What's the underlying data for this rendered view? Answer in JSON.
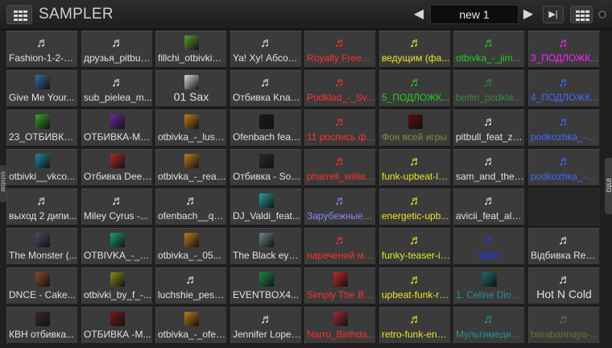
{
  "topbar": {
    "title": "SAMPLER",
    "bank_name": "new 1",
    "prev_glyph": "◀",
    "next_glyph": "▶",
    "skip_glyph": "▶|"
  },
  "left_sidebar_label": "sidebar",
  "right_panel_label": "info",
  "colors": {
    "white": "#e2e2e2",
    "red": "#ff3030",
    "yellow": "#e8e82a",
    "green": "#22cc22",
    "magenta": "#ff22ff",
    "blue": "#4466ff",
    "olive": "#8a8a3a",
    "darkgreen": "#3a8a3a",
    "darkteal": "#2a8f8f",
    "lavender": "#8888ff",
    "darkolive": "#6e6e32",
    "bluebright": "#2233ff"
  },
  "pads": [
    [
      {
        "label": "Fashion-1-2-3-...",
        "color": "white",
        "icon": "music-note-icon"
      },
      {
        "label": "друзья_pitbull...",
        "color": "white",
        "icon": "music-note-icon"
      },
      {
        "label": "fillchi_otbivki_-...",
        "color": "white",
        "icon": "album-cover-icon",
        "cover": "#5a9a2a"
      },
      {
        "label": "Ya! Xy! Абсол...",
        "color": "white",
        "icon": "music-note-icon"
      },
      {
        "label": "Royalty Free...",
        "color": "red",
        "icon": "music-note-icon"
      },
      {
        "label": "ведущим (фа...",
        "color": "yellow",
        "icon": "music-note-icon"
      },
      {
        "label": "otbivka_-_jim...",
        "color": "green",
        "icon": "music-note-icon"
      },
      {
        "label": "3_ПОДЛОЖК...",
        "color": "magenta",
        "icon": "music-note-icon"
      }
    ],
    [
      {
        "label": "Give Me Your...",
        "color": "white",
        "icon": "album-cover-icon",
        "cover": "#3a6aa0"
      },
      {
        "label": "sub_pielea_m...",
        "color": "white",
        "icon": "music-note-icon"
      },
      {
        "label": "01 Sax",
        "color": "white",
        "icon": "album-cover-icon",
        "cover": "#d9d9d9",
        "big": true
      },
      {
        "label": "Отбивка Knag...",
        "color": "white",
        "icon": "music-note-icon"
      },
      {
        "label": "Podklad_-_Sv...",
        "color": "red",
        "icon": "music-note-icon"
      },
      {
        "label": "5_ПОДЛОЖК...",
        "color": "green",
        "icon": "music-note-icon"
      },
      {
        "label": "berlin_podkla...",
        "color": "darkgreen",
        "icon": "music-note-icon"
      },
      {
        "label": "4_ПОДЛОЖК...",
        "color": "blue",
        "icon": "music-note-icon"
      }
    ],
    [
      {
        "label": "23_ОТБИВКА...",
        "color": "white",
        "icon": "album-cover-icon",
        "cover": "#3aa02a"
      },
      {
        "label": "ОТБИВКА-Му...",
        "color": "white",
        "icon": "album-cover-icon",
        "cover": "#6a2aa0"
      },
      {
        "label": "otbivka_-_lush...",
        "color": "white",
        "icon": "album-cover-icon",
        "cover": "#c07a1a"
      },
      {
        "label": "Ofenbach feat...",
        "color": "white",
        "icon": "album-cover-icon",
        "cover": "#1a1a1a"
      },
      {
        "label": "11 роспись ф...",
        "color": "red",
        "icon": "music-note-icon"
      },
      {
        "label": "Фон всей игры",
        "color": "olive",
        "icon": "album-cover-icon",
        "cover": "#5a1010"
      },
      {
        "label": "pitbull_feat_za...",
        "color": "white",
        "icon": "music-note-icon"
      },
      {
        "label": "podkozhka_-_j...",
        "color": "blue",
        "icon": "music-note-icon"
      }
    ],
    [
      {
        "label": "otbivki__vkco...",
        "color": "white",
        "icon": "album-cover-icon",
        "cover": "#1a8aa0"
      },
      {
        "label": "Отбивка Deep...",
        "color": "white",
        "icon": "album-cover-icon",
        "cover": "#b02a2a"
      },
      {
        "label": "otbivka_-_read...",
        "color": "white",
        "icon": "album-cover-icon",
        "cover": "#c07a1a"
      },
      {
        "label": "Отбивка - Sou...",
        "color": "white",
        "icon": "album-cover-icon",
        "cover": "#2a2a2a"
      },
      {
        "label": "pharrell_willia...",
        "color": "red",
        "icon": "music-note-icon"
      },
      {
        "label": "funk-upbeat-lo...",
        "color": "yellow",
        "icon": "music-note-icon"
      },
      {
        "label": "sam_and_the_...",
        "color": "white",
        "icon": "music-note-icon"
      },
      {
        "label": "podkozhka_-_v...",
        "color": "blue",
        "icon": "music-note-icon"
      }
    ],
    [
      {
        "label": "выход 2 дипи...",
        "color": "white",
        "icon": "music-note-icon"
      },
      {
        "label": "Miley Cyrus -...",
        "color": "white",
        "icon": "music-note-icon"
      },
      {
        "label": "ofenbach__qu...",
        "color": "white",
        "icon": "music-note-icon"
      },
      {
        "label": "DJ_Valdi_feat...",
        "color": "white",
        "icon": "album-cover-icon",
        "cover": "#2aa0a0"
      },
      {
        "label": "Зарубежные х...",
        "color": "lavender",
        "icon": "music-note-icon"
      },
      {
        "label": "energetic-upb...",
        "color": "yellow",
        "icon": "music-note-icon"
      },
      {
        "label": "avicii_feat_alo...",
        "color": "white",
        "icon": "music-note-icon"
      },
      {
        "empty": true
      }
    ],
    [
      {
        "label": "The Monster (...",
        "color": "white",
        "icon": "album-cover-icon",
        "cover": "#4a4a6a"
      },
      {
        "label": "OTBIVKA_-_S...",
        "color": "white",
        "icon": "album-cover-icon",
        "cover": "#1aa07a"
      },
      {
        "label": "otbivka_-_05...",
        "color": "white",
        "icon": "album-cover-icon",
        "cover": "#c07a1a"
      },
      {
        "label": "The Black eye...",
        "color": "white",
        "icon": "album-cover-icon",
        "cover": "#6a8a8a"
      },
      {
        "label": "наречений ма...",
        "color": "red",
        "icon": "music-note-icon"
      },
      {
        "label": "funky-teaser-in...",
        "color": "yellow",
        "icon": "music-note-icon"
      },
      {
        "label": "фон",
        "color": "bluebright",
        "icon": "music-note-icon",
        "big": true
      },
      {
        "label": "Відбивка Red...",
        "color": "white",
        "icon": "music-note-icon"
      }
    ],
    [
      {
        "label": "DNCE - Cake...",
        "color": "white",
        "icon": "album-cover-icon",
        "cover": "#8a4a2a"
      },
      {
        "label": "otbivki_by_f_-...",
        "color": "white",
        "icon": "album-cover-icon",
        "cover": "#8a8a1a"
      },
      {
        "label": "luchshie_pesni...",
        "color": "white",
        "icon": "music-note-icon"
      },
      {
        "label": "EVENTBOX4...",
        "color": "white",
        "icon": "album-cover-icon",
        "cover": "#1a8a4a"
      },
      {
        "label": "Simply The Be...",
        "color": "red",
        "icon": "album-cover-icon",
        "cover": "#c02a2a"
      },
      {
        "label": "upbeat-funk-rh...",
        "color": "yellow",
        "icon": "music-note-icon"
      },
      {
        "label": "1. Celine Dion...",
        "color": "darkteal",
        "icon": "album-cover-icon",
        "cover": "#1a6a6a"
      },
      {
        "label": "Hot N Cold",
        "color": "white",
        "icon": "music-note-icon",
        "big": true
      }
    ],
    [
      {
        "label": "КВН отбивка...",
        "color": "white",
        "icon": "album-cover-icon",
        "cover": "#3a2a2a"
      },
      {
        "label": "ОТБИВКА -М...",
        "color": "white",
        "icon": "album-cover-icon",
        "cover": "#7a1a1a"
      },
      {
        "label": "otbivka_-_ofen...",
        "color": "white",
        "icon": "album-cover-icon",
        "cover": "#c07a1a"
      },
      {
        "label": "Jennifer Lopez...",
        "color": "white",
        "icon": "music-note-icon"
      },
      {
        "label": "Narru_Birthda...",
        "color": "red",
        "icon": "album-cover-icon",
        "cover": "#a02a3a"
      },
      {
        "label": "retro-funk-ener...",
        "color": "yellow",
        "icon": "music-note-icon"
      },
      {
        "label": "Мультимедиа...",
        "color": "darkteal",
        "icon": "music-note-icon"
      },
      {
        "label": "barabannaya-...",
        "color": "darkolive",
        "icon": "music-note-icon"
      }
    ]
  ]
}
